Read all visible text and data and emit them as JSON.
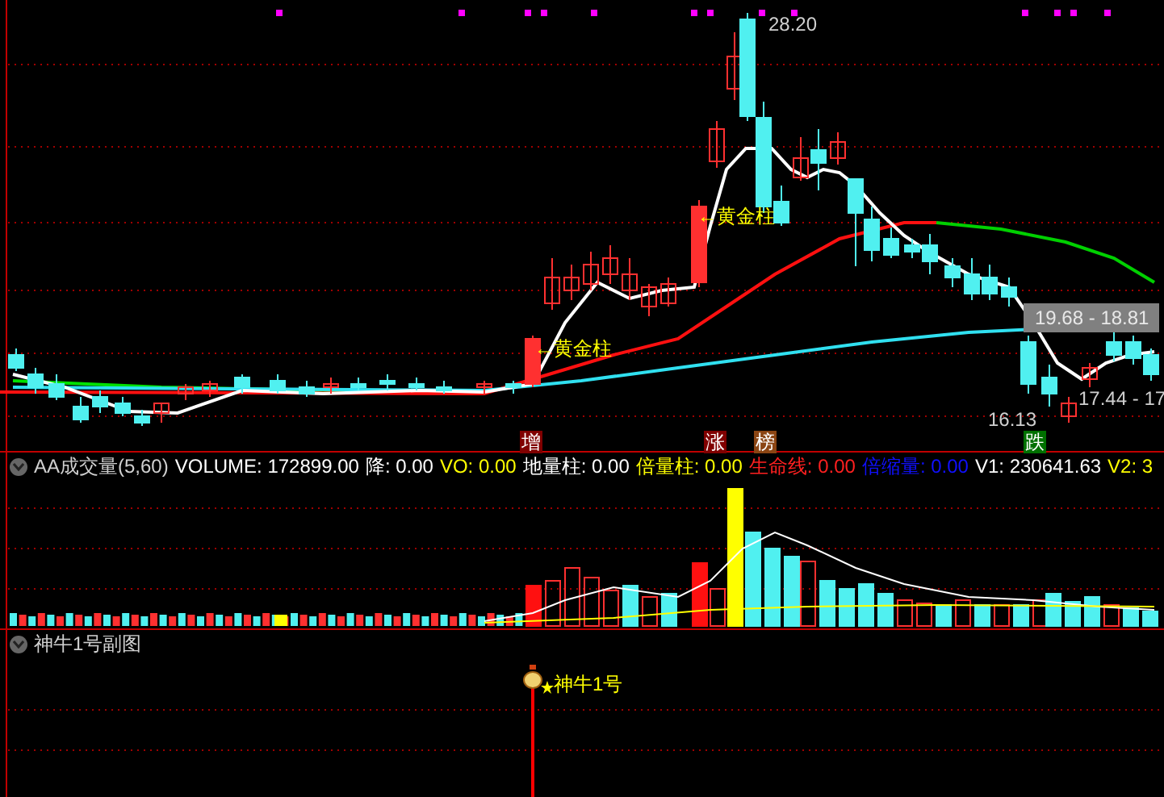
{
  "price_chart": {
    "price_markers": [
      {
        "text": "28.20"
      },
      {
        "text": "19.68 - 18.81"
      },
      {
        "text": "17.44 - 17"
      },
      {
        "text": "16.13"
      }
    ],
    "signals": [
      {
        "text": "←黄金柱"
      },
      {
        "text": "←黄金柱"
      }
    ],
    "tags": [
      {
        "text": "增",
        "color": "#800000"
      },
      {
        "text": "涨",
        "color": "#800000"
      },
      {
        "text": "榜",
        "color": "#8b4513"
      },
      {
        "text": "跌",
        "color": "#007000"
      }
    ]
  },
  "volume_panel": {
    "title": "AA成交量(5,60)",
    "indicators": [
      {
        "label": "VOLUME:",
        "value": "172899.00",
        "color": "#ffffff"
      },
      {
        "label": "降:",
        "value": "0.00",
        "color": "#ffffff"
      },
      {
        "label": "VO:",
        "value": "0.00",
        "color": "#ffff00"
      },
      {
        "label": "地量柱:",
        "value": "0.00",
        "color": "#ffffff"
      },
      {
        "label": "倍量柱:",
        "value": "0.00",
        "color": "#ffff00"
      },
      {
        "label": "生命线:",
        "value": "0.00",
        "color": "#ff2020"
      },
      {
        "label": "倍缩量:",
        "value": "0.00",
        "color": "#1010ff"
      },
      {
        "label": "V1:",
        "value": "230641.63",
        "color": "#ffffff"
      },
      {
        "label": "V2:",
        "value": "3",
        "color": "#ffff00"
      }
    ]
  },
  "sub_panel": {
    "title": "神牛1号副图",
    "signal": "神牛1号"
  }
}
